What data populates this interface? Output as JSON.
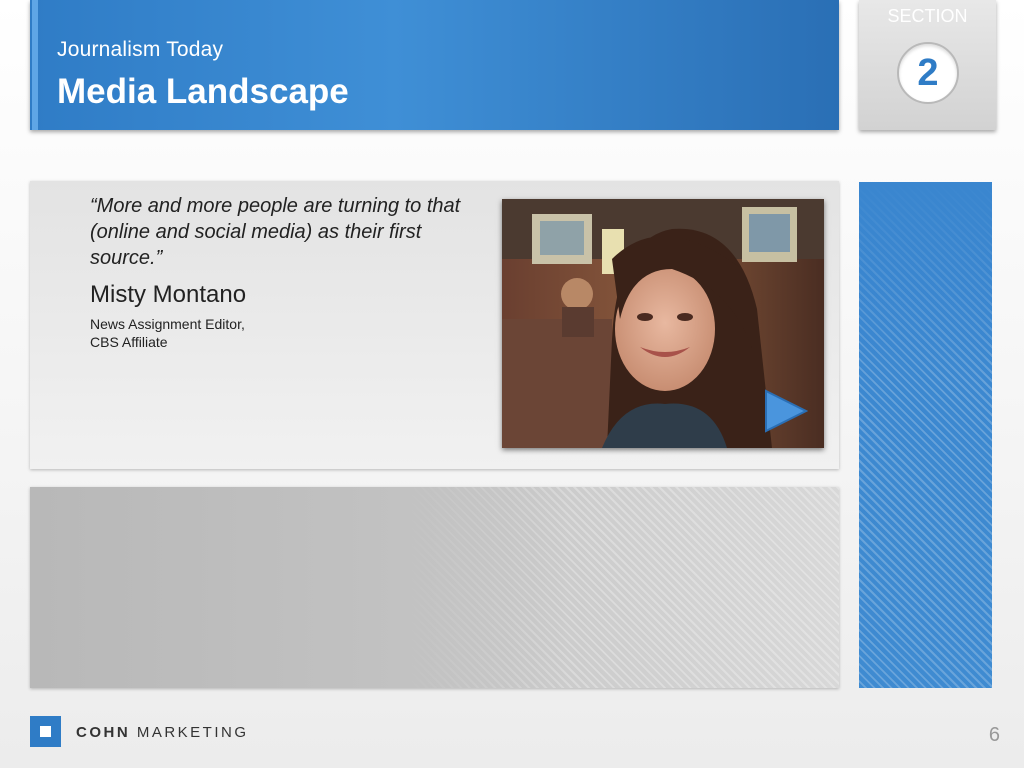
{
  "header": {
    "subtitle": "Journalism Today",
    "title": "Media Landscape"
  },
  "section": {
    "label": "SECTION",
    "number": "2"
  },
  "quote": {
    "text": "“More and more people are turning to that (online and social media) as their first source.”",
    "name": "Misty Montano",
    "title_line1": "News Assignment Editor,",
    "title_line2": "CBS Affiliate"
  },
  "video": {
    "play_icon": "play-triangle-icon"
  },
  "footer": {
    "logo_bold": "COHN",
    "logo_regular": "MARKETING",
    "page_number": "6"
  },
  "colors": {
    "brand_blue": "#2f7cc6",
    "accent_light_blue": "#5fa6e6"
  }
}
